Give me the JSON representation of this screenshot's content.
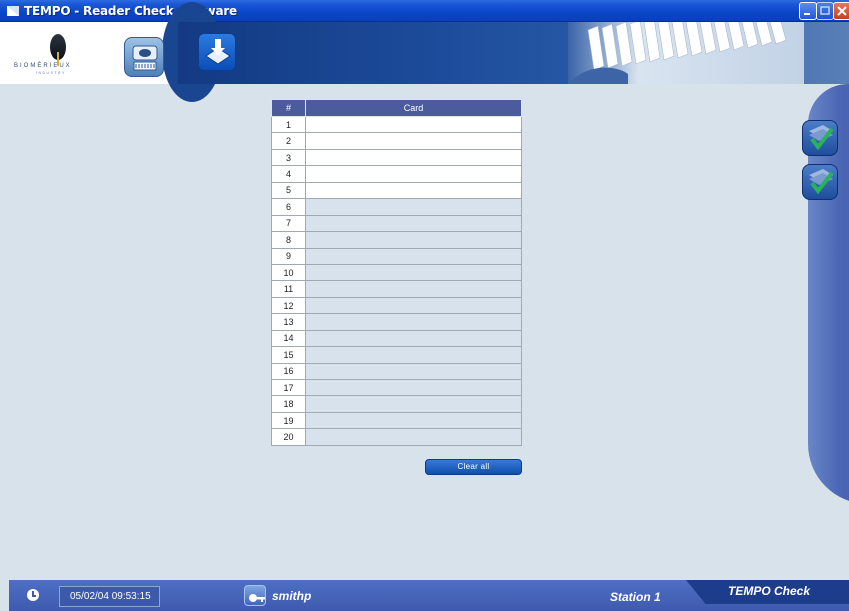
{
  "window": {
    "title": "TEMPO - Reader Check Software"
  },
  "header": {
    "logo_brand": "BIOMÉRIEUX",
    "logo_sub": "INDUSTRY"
  },
  "table": {
    "columns": [
      "#",
      "Card"
    ],
    "rows": [
      {
        "num": "1",
        "card": "",
        "style": "white"
      },
      {
        "num": "2",
        "card": "",
        "style": "white"
      },
      {
        "num": "3",
        "card": "",
        "style": "white"
      },
      {
        "num": "4",
        "card": "",
        "style": "white"
      },
      {
        "num": "5",
        "card": "",
        "style": "white"
      },
      {
        "num": "6",
        "card": "",
        "style": "grey"
      },
      {
        "num": "7",
        "card": "",
        "style": "grey"
      },
      {
        "num": "8",
        "card": "",
        "style": "grey"
      },
      {
        "num": "9",
        "card": "",
        "style": "grey"
      },
      {
        "num": "10",
        "card": "",
        "style": "grey"
      },
      {
        "num": "11",
        "card": "",
        "style": "grey"
      },
      {
        "num": "12",
        "card": "",
        "style": "grey"
      },
      {
        "num": "13",
        "card": "",
        "style": "grey"
      },
      {
        "num": "14",
        "card": "",
        "style": "grey"
      },
      {
        "num": "15",
        "card": "",
        "style": "grey"
      },
      {
        "num": "16",
        "card": "",
        "style": "grey"
      },
      {
        "num": "17",
        "card": "",
        "style": "grey"
      },
      {
        "num": "18",
        "card": "",
        "style": "grey"
      },
      {
        "num": "19",
        "card": "",
        "style": "grey"
      },
      {
        "num": "20",
        "card": "",
        "style": "grey"
      }
    ]
  },
  "actions": {
    "clear_all_label": "Clear all"
  },
  "status": {
    "datetime": "05/02/04 09:53:15",
    "username": "smithp",
    "station": "Station 1",
    "product": "TEMPO Check"
  },
  "icons": {
    "app": "tempo-app-icon",
    "reader": "reader-device-icon",
    "download": "download-icon",
    "check_1": "check-icon",
    "check_2": "check-icon",
    "clock": "clock-icon",
    "user": "user-key-icon"
  },
  "colors": {
    "titlebar": "#0a46c8",
    "header_band": "#1d4c9c",
    "table_header": "#4b5b9d",
    "row_grey": "#d7e2ec",
    "statusbar": "#3e5aae",
    "button": "#0d4eb0"
  }
}
